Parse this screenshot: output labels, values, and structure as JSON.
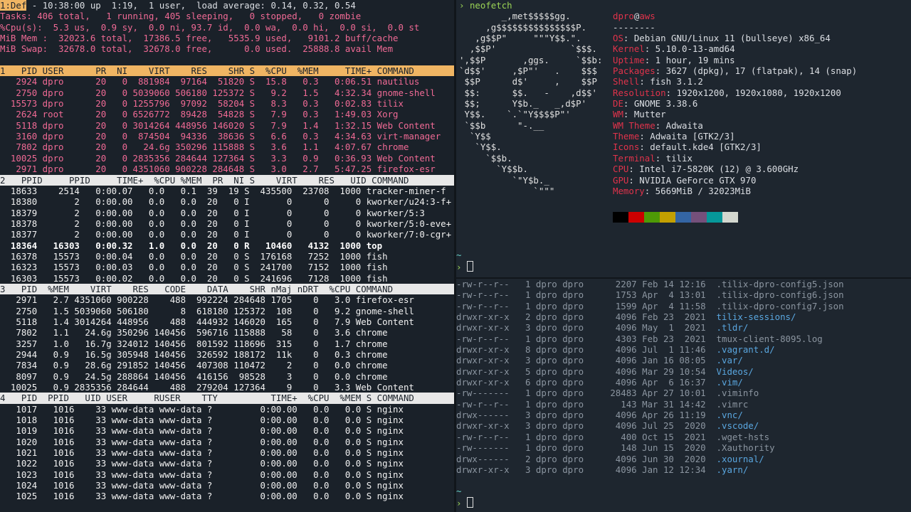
{
  "top": {
    "tab_label": "1:Def",
    "line1": " - 10:38:00 up  1:19,  1 user,  load average: 0.14, 0.32, 0.54",
    "tasks": "Tasks: 406 total,   1 running, 405 sleeping,   0 stopped,   0 zombie",
    "cpu": "%Cpu(s):  5.3 us,  0.9 sy,  0.0 ni, 93.7 id,  0.0 wa,  0.0 hi,  0.0 si,  0.0 st",
    "mem": "MiB Mem :  32023.6 total,  17386.5 free,   5535.9 used,   9101.2 buff/cache",
    "swap": "MiB Swap:  32678.0 total,  32678.0 free,      0.0 used.  25888.8 avail Mem",
    "section1": {
      "header": "1   PID USER      PR  NI    VIRT    RES    SHR S  %CPU  %MEM     TIME+ COMMAND",
      "rows": [
        "   2924 dpro      20   0  881984  97164  51820 S  15.8   0.3   0:06.51 nautilus",
        "   2750 dpro      20   0 5039060 506180 125372 S   9.2   1.5   4:32.34 gnome-shell",
        "  15573 dpro      20   0 1255796  97092  58204 S   8.3   0.3   0:02.83 tilix",
        "   2624 root      20   0 6526772  89428  54828 S   7.9   0.3   1:49.03 Xorg",
        "   5118 dpro      20   0 3014264 448956 146020 S   7.9   1.4   1:32.15 Web Content",
        "   3160 dpro      20   0  874504  94336  38636 S   6.6   0.3   4:34.63 virt-manager",
        "   7802 dpro      20   0   24.6g 350296 115888 S   3.6   1.1   4:07.67 chrome",
        "  10025 dpro      20   0 2835356 284644 127364 S   3.3   0.9   0:36.93 Web Content",
        "   2971 dpro      20   0 4351060 900228 284648 S   3.0   2.7   5:47.25 firefox-esr"
      ]
    },
    "section2": {
      "header": "2   PPID     PPID     TIME+  %CPU %MEM  PR  NI S    VIRT    RES   UID COMMAND",
      "rows": [
        "  18633    2514   0:00.07   0.0   0.1  39  19 S  435500  23708  1000 tracker-miner-f",
        "  18380       2   0:00.00   0.0   0.0  20   0 I       0      0     0 kworker/u24:3-f+",
        "  18379       2   0:00.00   0.0   0.0  20   0 I       0      0     0 kworker/5:3",
        "  18378       2   0:00.00   0.0   0.0  20   0 I       0      0     0 kworker/5:0-eve+",
        "  18377       2   0:00.00   0.0   0.0  20   0 I       0      0     0 kworker/7:0-cgr+",
        "  18364   16303   0:00.32   1.0   0.0  20   0 R   10460   4132  1000 top",
        "  16378   15573   0:00.04   0.0   0.0  20   0 S  176168   7252  1000 fish",
        "  16323   15573   0:00.03   0.0   0.0  20   0 S  241700   7152  1000 fish",
        "  16303   15573   0:00.02   0.0   0.0  20   0 S  241696   7128  1000 fish"
      ]
    },
    "section3": {
      "header": "3   PID  %MEM    VIRT    RES   CODE    DATA    SHR nMaj nDRT  %CPU COMMAND",
      "rows": [
        "   2971   2.7 4351060 900228    488  992224 284648 1705    0   3.0 firefox-esr",
        "   2750   1.5 5039060 506180      8  618180 125372  108    0   9.2 gnome-shell",
        "   5118   1.4 3014264 448956    488  444932 146020  165    0   7.9 Web Content",
        "   7802   1.1   24.6g 350296 140456  596716 115888   58    0   3.6 chrome",
        "   3257   1.0   16.7g 324012 140456  801592 118696  315    0   1.7 chrome",
        "   2944   0.9   16.5g 305948 140456  326592 188172  11k    0   0.3 chrome",
        "   7834   0.9   28.6g 291852 140456  407308 110472    2    0   0.0 chrome",
        "   8097   0.9   24.5g 288864 140456  416156  98528    3    0   0.0 chrome",
        "  10025   0.9 2835356 284644    488  279204 127364    9    0   3.3 Web Content"
      ]
    },
    "section4": {
      "header": "4   PID  PPID   UID USER     RUSER    TTY          TIME+  %CPU  %MEM S COMMAND",
      "rows": [
        "   1017   1016    33 www-data www-data ?         0:00.00   0.0   0.0 S nginx",
        "   1018   1016    33 www-data www-data ?         0:00.00   0.0   0.0 S nginx",
        "   1019   1016    33 www-data www-data ?         0:00.00   0.0   0.0 S nginx",
        "   1020   1016    33 www-data www-data ?         0:00.00   0.0   0.0 S nginx",
        "   1021   1016    33 www-data www-data ?         0:00.00   0.0   0.0 S nginx",
        "   1022   1016    33 www-data www-data ?         0:00.00   0.0   0.0 S nginx",
        "   1023   1016    33 www-data www-data ?         0:00.00   0.0   0.0 S nginx",
        "   1024   1016    33 www-data www-data ?         0:00.00   0.0   0.0 S nginx",
        "   1025   1016    33 www-data www-data ?         0:00.00   0.0   0.0 S nginx"
      ]
    }
  },
  "neofetch": {
    "command": "neofetch",
    "prompt_symbol": "›",
    "tilde": "~",
    "art": [
      "        _,met$$$$$gg.",
      "     ,g$$$$$$$$$$$$$$$P.",
      "   ,g$$P\"     \"\"\"Y$$.\".",
      "  ,$$P'              `$$$.",
      "',$$P       ,ggs.     `$$b:",
      "`d$$'     ,$P\"'   .    $$$",
      " $$P      d$'     ,    $$P",
      " $$:      $$.   -    ,d$$'",
      " $$;      Y$b._   _,d$P'",
      " Y$$.    `.`\"Y$$$$P\"'",
      " `$$b      \"-.__",
      "  `Y$$",
      "   `Y$$.",
      "     `$$b.",
      "       `Y$$b.",
      "          `\"Y$b._",
      "              `\"\"\""
    ],
    "user": "dpro",
    "at": "@",
    "host": "aws",
    "separator": "--------",
    "info": [
      {
        "key": "OS",
        "value": ": Debian GNU/Linux 11 (bullseye) x86_64"
      },
      {
        "key": "Kernel",
        "value": ": 5.10.0-13-amd64"
      },
      {
        "key": "Uptime",
        "value": ": 1 hour, 19 mins"
      },
      {
        "key": "Packages",
        "value": ": 3627 (dpkg), 17 (flatpak), 14 (snap)"
      },
      {
        "key": "Shell",
        "value": ": fish 3.1.2"
      },
      {
        "key": "Resolution",
        "value": ": 1920x1200, 1920x1080, 1920x1200"
      },
      {
        "key": "DE",
        "value": ": GNOME 3.38.6"
      },
      {
        "key": "WM",
        "value": ": Mutter"
      },
      {
        "key": "WM Theme",
        "value": ": Adwaita"
      },
      {
        "key": "Theme",
        "value": ": Adwaita [GTK2/3]"
      },
      {
        "key": "Icons",
        "value": ": default.kde4 [GTK2/3]"
      },
      {
        "key": "Terminal",
        "value": ": tilix"
      },
      {
        "key": "CPU",
        "value": ": Intel i7-5820K (12) @ 3.600GHz"
      },
      {
        "key": "GPU",
        "value": ": NVIDIA GeForce GTX 970"
      },
      {
        "key": "Memory",
        "value": ": 5669MiB / 32023MiB"
      }
    ],
    "palette": [
      "#000000",
      "#cc0000",
      "#4e9a06",
      "#c4a000",
      "#3465a4",
      "#75507b",
      "#06989a",
      "#d3d7cf"
    ]
  },
  "ls": {
    "rows": [
      {
        "perm": "-rw-r--r--",
        "rest": "   1 dpro dpro      2207 Feb 14 12:16  ",
        "name": ".tilix-dpro-config5.json",
        "dir": false
      },
      {
        "perm": "-rw-r--r--",
        "rest": "   1 dpro dpro      1753 Apr  4 13:01  ",
        "name": ".tilix-dpro-config6.json",
        "dir": false
      },
      {
        "perm": "-rw-r--r--",
        "rest": "   1 dpro dpro      1599 Apr  4 11:58  ",
        "name": ".tilix-dpro-config7.json",
        "dir": false
      },
      {
        "perm": "drwxr-xr-x",
        "rest": "   2 dpro dpro      4096 Feb 23  2021  ",
        "name": "tilix-sessions/",
        "dir": true
      },
      {
        "perm": "drwxr-xr-x",
        "rest": "   3 dpro dpro      4096 May  1  2021  ",
        "name": ".tldr/",
        "dir": true
      },
      {
        "perm": "-rw-r--r--",
        "rest": "   1 dpro dpro      4303 Feb 23  2021  ",
        "name": "tmux-client-8095.log",
        "dir": false
      },
      {
        "perm": "drwxr-xr-x",
        "rest": "   8 dpro dpro      4096 Jul  1 11:46  ",
        "name": ".vagrant.d/",
        "dir": true
      },
      {
        "perm": "drwxr-xr-x",
        "rest": "   3 dpro dpro      4096 Jan 16 08:05  ",
        "name": ".var/",
        "dir": true
      },
      {
        "perm": "drwxr-xr-x",
        "rest": "   5 dpro dpro      4096 Mar 29 10:54  ",
        "name": "Videos/",
        "dir": true
      },
      {
        "perm": "drwxr-xr-x",
        "rest": "   6 dpro dpro      4096 Apr  6 16:37  ",
        "name": ".vim/",
        "dir": true
      },
      {
        "perm": "-rw-------",
        "rest": "   1 dpro dpro     28483 Apr 27 10:01  ",
        "name": ".viminfo",
        "dir": false
      },
      {
        "perm": "-rw-r--r--",
        "rest": "   1 dpro dpro       143 Mar 31 14:42  ",
        "name": ".vimrc",
        "dir": false
      },
      {
        "perm": "drwx------",
        "rest": "   3 dpro dpro      4096 Apr 26 11:19  ",
        "name": ".vnc/",
        "dir": true
      },
      {
        "perm": "drwxr-xr-x",
        "rest": "   3 dpro dpro      4096 Jul 25  2020  ",
        "name": ".vscode/",
        "dir": true
      },
      {
        "perm": "-rw-r--r--",
        "rest": "   1 dpro dpro       400 Oct 15  2021  ",
        "name": ".wget-hsts",
        "dir": false
      },
      {
        "perm": "-rw-------",
        "rest": "   1 dpro dpro       148 Jun 15  2020  ",
        "name": ".Xauthority",
        "dir": false
      },
      {
        "perm": "drwx------",
        "rest": "   2 dpro dpro      4096 Jun 30  2020  ",
        "name": ".xournal/",
        "dir": true
      },
      {
        "perm": "drwxr-xr-x",
        "rest": "   3 dpro dpro      4096 Jan 12 12:34  ",
        "name": ".yarn/",
        "dir": true
      }
    ],
    "tilde": "~",
    "prompt_symbol": "›"
  }
}
